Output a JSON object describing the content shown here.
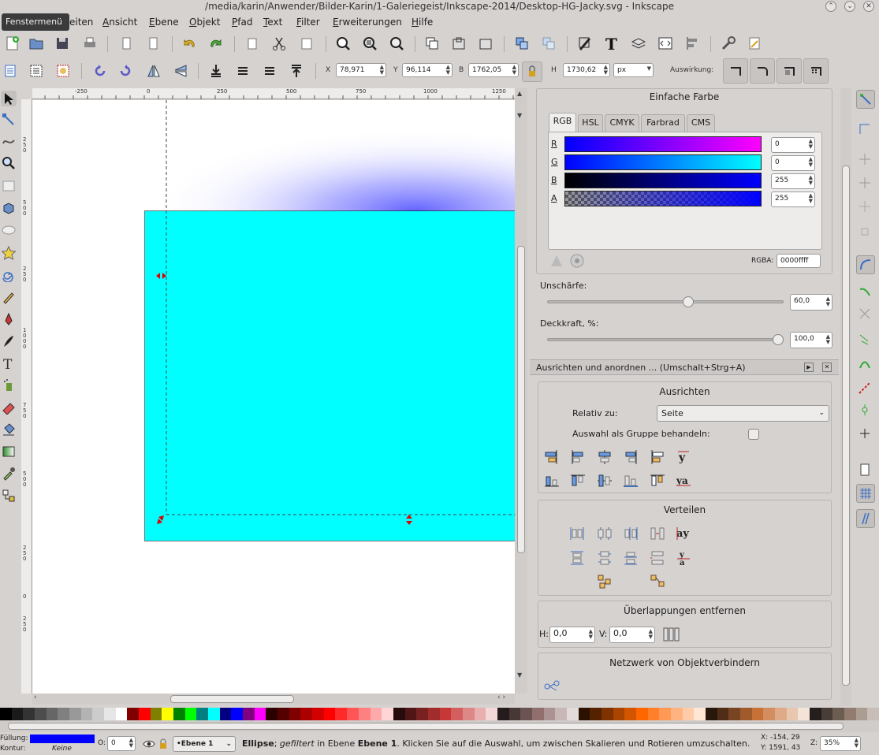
{
  "window": {
    "title": "/media/karin/Anwender/Bilder-Karin/1-Galeriegeist/Inkscape-2014/Desktop-HG-Jacky.svg - Inkscape",
    "tooltip": "Fenstermenü"
  },
  "menu": [
    {
      "label": "Bearbeiten",
      "visible": "eiten",
      "key": ""
    },
    {
      "label": "Ansicht",
      "key": "A",
      "rest": "nsicht"
    },
    {
      "label": "Ebene",
      "key": "E",
      "rest": "bene"
    },
    {
      "label": "Objekt",
      "key": "O",
      "rest": "bjekt"
    },
    {
      "label": "Pfad",
      "key": "P",
      "rest": "fad"
    },
    {
      "label": "Text",
      "key": "T",
      "rest": "ext"
    },
    {
      "label": "Filter",
      "key": "F",
      "rest": "ilter"
    },
    {
      "label": "Erweiterungen",
      "key": "E",
      "rest": "rweiterungen"
    },
    {
      "label": "Hilfe",
      "key": "H",
      "rest": "ilfe"
    }
  ],
  "controls": {
    "x_label": "X",
    "x_value": "78,971",
    "y_label": "Y",
    "y_value": "96,114",
    "w_label": "B",
    "w_value": "1762,05",
    "h_label": "H",
    "h_value": "1730,62",
    "unit": "px",
    "effect_label": "Auswirkung:"
  },
  "ruler": {
    "h_ticks": [
      "-250",
      "0",
      "250",
      "500",
      "750",
      "1000",
      "1250"
    ],
    "v_ticks": [
      "2\n5\n0",
      "5\n0\n0",
      "2\n5\n0",
      "1\n0\n0\n0",
      "7\n5\n0",
      "5\n0\n0",
      "2\n5\n0",
      "0",
      "2\n5\n0"
    ]
  },
  "fill_panel": {
    "heading": "Einfache Farbe",
    "tabs": [
      "RGB",
      "HSL",
      "CMYK",
      "Farbrad",
      "CMS"
    ],
    "channels": [
      {
        "label": "R",
        "value": "0"
      },
      {
        "label": "G",
        "value": "0"
      },
      {
        "label": "B",
        "value": "255"
      },
      {
        "label": "A",
        "value": "255"
      }
    ],
    "rgba_label": "RGBA:",
    "rgba_value": "0000ffff",
    "blur_label": "Unschärfe:",
    "blur_value": "60,0",
    "blur_level": 0.6,
    "opacity_label": "Deckkraft, %:",
    "opacity_value": "100,0",
    "opacity_level": 1.0
  },
  "align_panel": {
    "title": "Ausrichten und anordnen ... (Umschalt+Strg+A)",
    "align_heading": "Ausrichten",
    "relative_label": "Relativ zu:",
    "relative_value": "Seite",
    "group_label": "Auswahl als Gruppe behandeln:",
    "distribute_heading": "Verteilen",
    "overlap_heading": "Überlappungen entfernen",
    "h_label": "H:",
    "h_value": "0,0",
    "v_label": "V:",
    "v_value": "0,0",
    "network_heading": "Netzwerk von Objektverbindern"
  },
  "status": {
    "fill_label": "Füllung:",
    "stroke_label": "Kontur:",
    "stroke_value": "Keine",
    "opacity_label": "O:",
    "opacity_value": "0",
    "layer": "•Ebene 1",
    "message_obj": "Ellipse",
    "message_filtered": "gefiltert",
    "message_in": " in Ebene ",
    "message_layer": "Ebene 1",
    "message_rest": ". Klicken Sie auf die Auswahl, um zwischen Skalieren und Rotieren umzuschalten.",
    "x_readout": "X: -154, 29",
    "y_readout": "Y: 1591, 43",
    "zoom_label": "Z:",
    "zoom_value": "35%"
  },
  "colors": {
    "accent_cyan": "#00ffff",
    "blue": "#0000ff",
    "handle_red": "#e00000"
  }
}
